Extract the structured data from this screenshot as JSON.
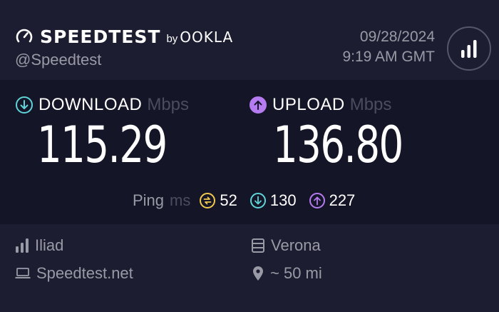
{
  "header": {
    "brand": "SPEEDTEST",
    "by": "by",
    "ookla": "OOKLA",
    "handle": "@Speedtest",
    "date": "09/28/2024",
    "time": "9:19 AM GMT",
    "results_icon": "results-bars-icon",
    "logo_icon": "gauge-icon"
  },
  "download": {
    "label": "DOWNLOAD",
    "unit": "Mbps",
    "value": "115.29",
    "icon": "arrow-down-circle-icon",
    "color": "#5fd4d9"
  },
  "upload": {
    "label": "UPLOAD",
    "unit": "Mbps",
    "value": "136.80",
    "icon": "arrow-up-circle-icon",
    "color": "#b57bf0"
  },
  "ping": {
    "label": "Ping",
    "unit": "ms",
    "idle": {
      "value": "52",
      "icon": "idle-latency-icon",
      "color": "#f2c94c"
    },
    "download": {
      "value": "130",
      "icon": "arrow-down-circle-icon",
      "color": "#5fd4d9"
    },
    "upload": {
      "value": "227",
      "icon": "arrow-up-circle-icon",
      "color": "#b57bf0"
    }
  },
  "info": {
    "isp": {
      "text": "Iliad",
      "icon": "signal-bars-icon"
    },
    "server": {
      "text": "Verona",
      "icon": "server-icon"
    },
    "host": {
      "text": "Speedtest.net",
      "icon": "laptop-icon"
    },
    "distance": {
      "text": "~ 50 mi",
      "icon": "location-pin-icon"
    }
  },
  "colors": {
    "background": "#141526",
    "header": "#1c1d30",
    "muted": "#9a9aa6",
    "dim": "#4b4c5e"
  }
}
